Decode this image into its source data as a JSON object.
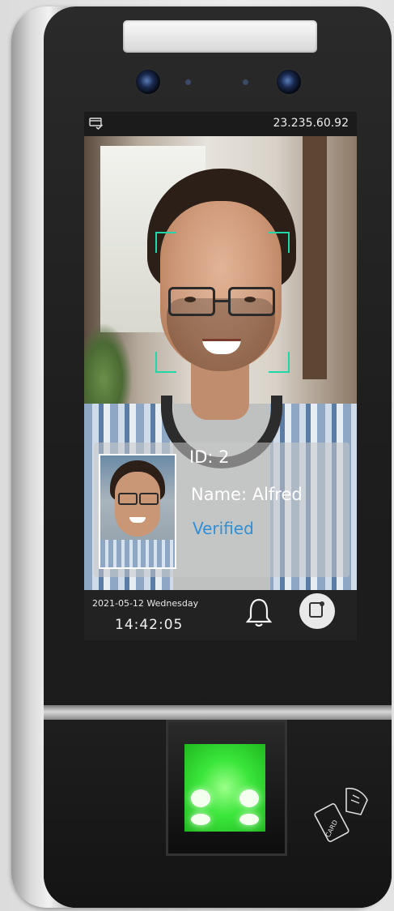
{
  "status_bar": {
    "ip_address": "23.235.60.92",
    "card_status_icon": "card-check-icon"
  },
  "recognition": {
    "id_text": "ID: 2",
    "name_text": "Name: Alfred",
    "status_text": "Verified"
  },
  "footer": {
    "date": "2021-05-12 Wednesday",
    "time": "14:42:05",
    "bell_icon": "bell-icon",
    "card_button_icon": "card-icon"
  },
  "reader_label": "CARD",
  "colors": {
    "accent_bracket": "#1fd7a8",
    "verified": "#2f8fd8",
    "fingerprint_glow": "#3be63a"
  }
}
